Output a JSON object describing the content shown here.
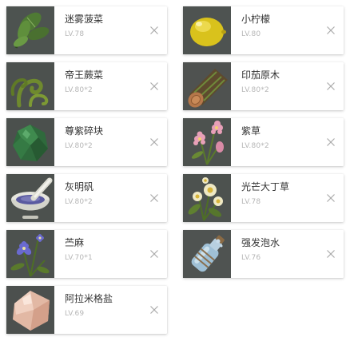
{
  "items": [
    {
      "name": "迷雾菠菜",
      "level": "LV.78",
      "icon": "spinach-icon",
      "remove_icon": "close-icon"
    },
    {
      "name": "小柠檬",
      "level": "LV.80",
      "icon": "lemon-icon",
      "remove_icon": "close-icon"
    },
    {
      "name": "帝王蕨菜",
      "level": "LV.80*2",
      "icon": "fern-icon",
      "remove_icon": "close-icon"
    },
    {
      "name": "印茄原木",
      "level": "LV.80*2",
      "icon": "log-icon",
      "remove_icon": "close-icon"
    },
    {
      "name": "尊紫碎块",
      "level": "LV.80*2",
      "icon": "green-crystal-icon",
      "remove_icon": "close-icon"
    },
    {
      "name": "紫草",
      "level": "LV.80*2",
      "icon": "pink-flower-icon",
      "remove_icon": "close-icon"
    },
    {
      "name": "灰明矾",
      "level": "LV.80*2",
      "icon": "mortar-icon",
      "remove_icon": "close-icon"
    },
    {
      "name": "光芒大丁草",
      "level": "LV.78",
      "icon": "white-flower-icon",
      "remove_icon": "close-icon"
    },
    {
      "name": "苎麻",
      "level": "LV.70*1",
      "icon": "purple-flower-icon",
      "remove_icon": "close-icon"
    },
    {
      "name": "强发泡水",
      "level": "LV.76",
      "icon": "water-bottle-icon",
      "remove_icon": "close-icon"
    },
    {
      "name": "阿拉米格盐",
      "level": "LV.69",
      "icon": "salt-crystal-icon",
      "remove_icon": "close-icon"
    }
  ]
}
